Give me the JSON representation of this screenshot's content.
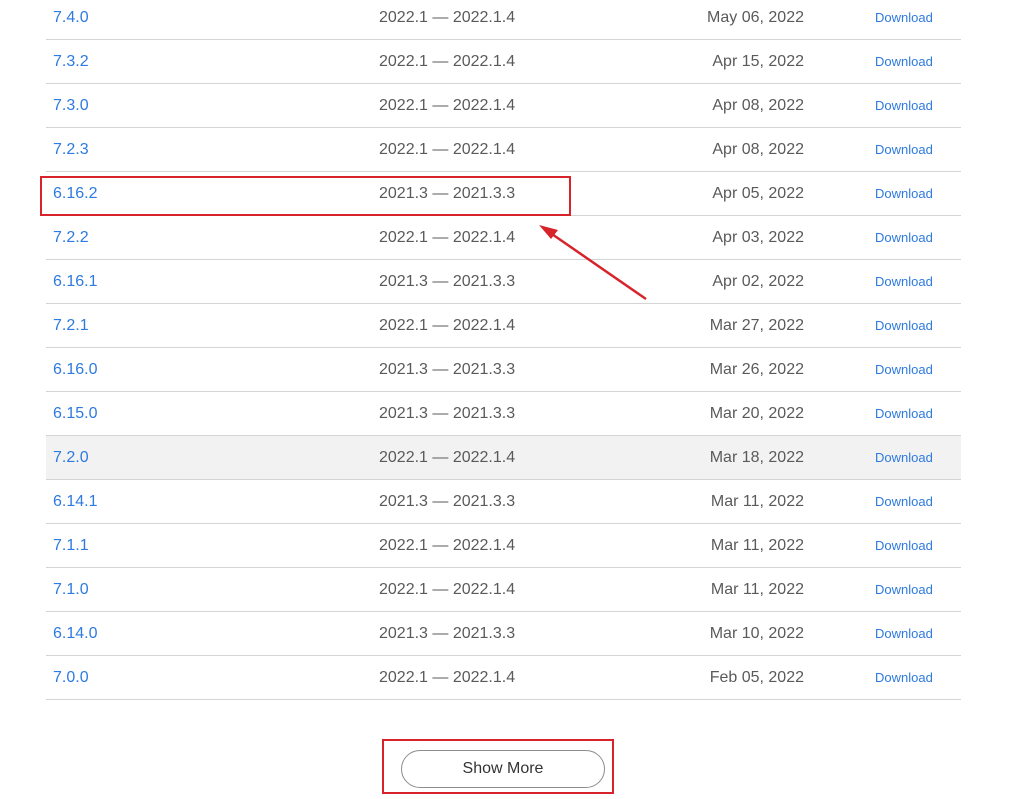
{
  "releases": [
    {
      "version": "7.4.0",
      "range": "2022.1 — 2022.1.4",
      "date": "May 06, 2022",
      "download": "Download"
    },
    {
      "version": "7.3.2",
      "range": "2022.1 — 2022.1.4",
      "date": "Apr 15, 2022",
      "download": "Download"
    },
    {
      "version": "7.3.0",
      "range": "2022.1 — 2022.1.4",
      "date": "Apr 08, 2022",
      "download": "Download"
    },
    {
      "version": "7.2.3",
      "range": "2022.1 — 2022.1.4",
      "date": "Apr 08, 2022",
      "download": "Download"
    },
    {
      "version": "6.16.2",
      "range": "2021.3 — 2021.3.3",
      "date": "Apr 05, 2022",
      "download": "Download"
    },
    {
      "version": "7.2.2",
      "range": "2022.1 — 2022.1.4",
      "date": "Apr 03, 2022",
      "download": "Download"
    },
    {
      "version": "6.16.1",
      "range": "2021.3 — 2021.3.3",
      "date": "Apr 02, 2022",
      "download": "Download"
    },
    {
      "version": "7.2.1",
      "range": "2022.1 — 2022.1.4",
      "date": "Mar 27, 2022",
      "download": "Download"
    },
    {
      "version": "6.16.0",
      "range": "2021.3 — 2021.3.3",
      "date": "Mar 26, 2022",
      "download": "Download"
    },
    {
      "version": "6.15.0",
      "range": "2021.3 — 2021.3.3",
      "date": "Mar 20, 2022",
      "download": "Download"
    },
    {
      "version": "7.2.0",
      "range": "2022.1 — 2022.1.4",
      "date": "Mar 18, 2022",
      "download": "Download"
    },
    {
      "version": "6.14.1",
      "range": "2021.3 — 2021.3.3",
      "date": "Mar 11, 2022",
      "download": "Download"
    },
    {
      "version": "7.1.1",
      "range": "2022.1 — 2022.1.4",
      "date": "Mar 11, 2022",
      "download": "Download"
    },
    {
      "version": "7.1.0",
      "range": "2022.1 — 2022.1.4",
      "date": "Mar 11, 2022",
      "download": "Download"
    },
    {
      "version": "6.14.0",
      "range": "2021.3 — 2021.3.3",
      "date": "Mar 10, 2022",
      "download": "Download"
    },
    {
      "version": "7.0.0",
      "range": "2022.1 — 2022.1.4",
      "date": "Feb 05, 2022",
      "download": "Download"
    }
  ],
  "hovered_row": "7.2.0",
  "highlighted_row": "6.16.2",
  "show_more_label": "Show More",
  "colors": {
    "link": "#2d7ae0",
    "text": "#5a5a5a",
    "annotation": "#d6242a",
    "row_hover": "#f2f2f2",
    "divider": "#d4d4d4"
  }
}
